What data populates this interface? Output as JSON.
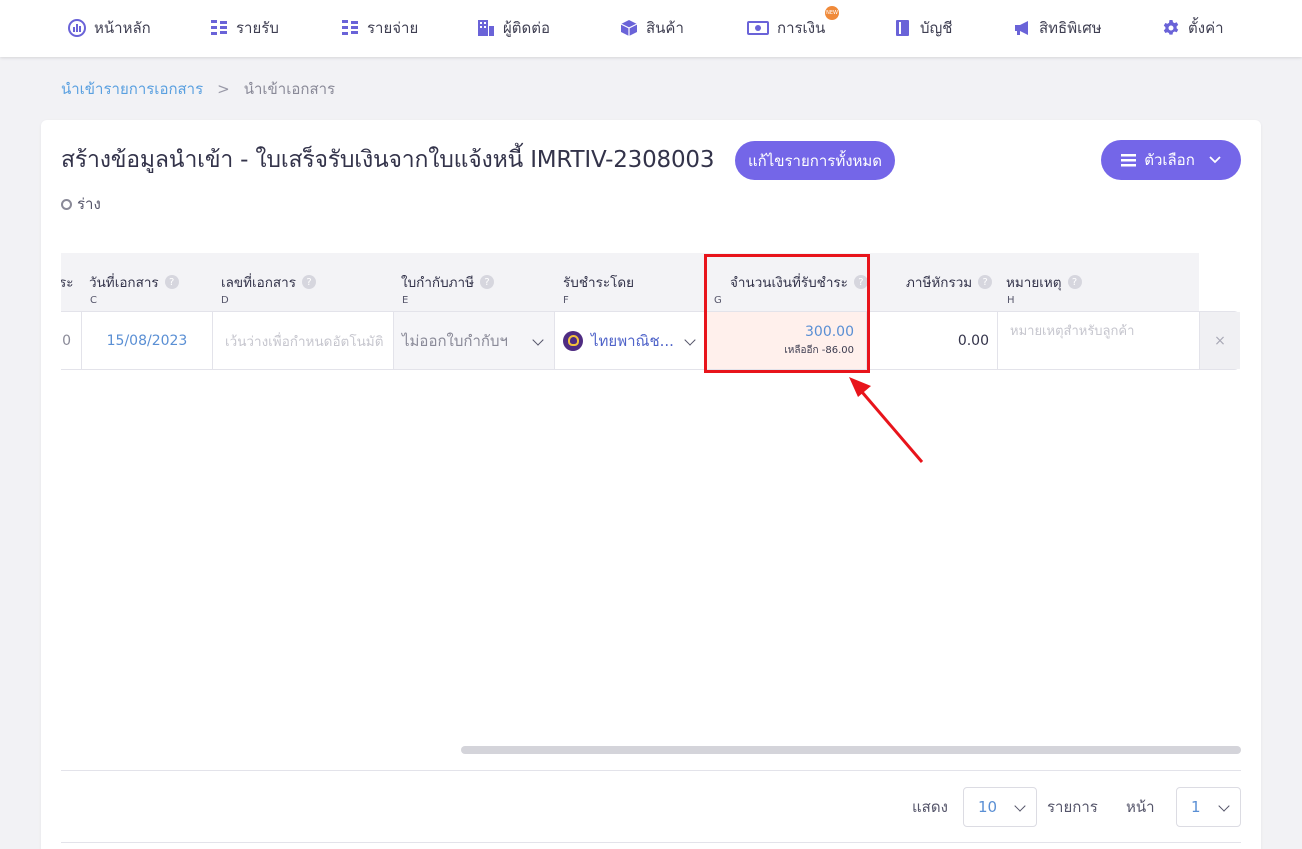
{
  "nav": {
    "items": [
      {
        "label": "หน้าหลัก",
        "icon": "dashboard-icon"
      },
      {
        "label": "รายรับ",
        "icon": "income-icon"
      },
      {
        "label": "รายจ่าย",
        "icon": "expense-icon"
      },
      {
        "label": "ผู้ติดต่อ",
        "icon": "contacts-icon"
      },
      {
        "label": "สินค้า",
        "icon": "product-box-icon"
      },
      {
        "label": "การเงิน",
        "icon": "money-icon",
        "badge": "NEW"
      },
      {
        "label": "บัญชี",
        "icon": "accounting-book-icon"
      },
      {
        "label": "สิทธิพิเศษ",
        "icon": "megaphone-icon"
      },
      {
        "label": "ตั้งค่า",
        "icon": "gear-icon"
      }
    ]
  },
  "breadcrumb": {
    "parent": "นำเข้ารายการเอกสาร",
    "separator": ">",
    "current": "นำเข้าเอกสาร"
  },
  "header": {
    "title": "สร้างข้อมูลนำเข้า - ใบเสร็จรับเงินจากใบแจ้งหนี้ IMRTIV-2308003",
    "edit_all_label": "แก้ไขรายการทั้งหมด",
    "options_label": "ตัวเลือก",
    "status": "ร่าง"
  },
  "table": {
    "columns": [
      {
        "label": "ระ",
        "letter": ""
      },
      {
        "label": "วันที่เอกสาร",
        "letter": "C"
      },
      {
        "label": "เลขที่เอกสาร",
        "letter": "D"
      },
      {
        "label": "ใบกำกับภาษี",
        "letter": "E"
      },
      {
        "label": "รับชำระโดย",
        "letter": "F"
      },
      {
        "label": "จำนวนเงินที่รับชำระ",
        "letter": "G"
      },
      {
        "label": "ภาษีหักรวม",
        "letter": ""
      },
      {
        "label": "หมายเหตุ",
        "letter": "H"
      }
    ],
    "row": {
      "partial": "0",
      "date": "15/08/2023",
      "doc_no_placeholder": "เว้นว่างเพื่อกำหนดอัตโนมัติ",
      "tax_invoice": "ไม่ออกใบกำกับฯ",
      "payment_method": "ไทยพาณิช...",
      "amount": "300.00",
      "remaining": "เหลืออีก -86.00",
      "withholding": "0.00",
      "note_placeholder": "หมายเหตุสำหรับลูกค้า",
      "remove": "×"
    }
  },
  "pagination": {
    "show_label": "แสดง",
    "page_size": "10",
    "items_label": "รายการ",
    "page_label": "หน้า",
    "page": "1"
  },
  "colors": {
    "primary": "#7466e8",
    "highlight": "#e8141b",
    "link": "#5a8fd4"
  }
}
